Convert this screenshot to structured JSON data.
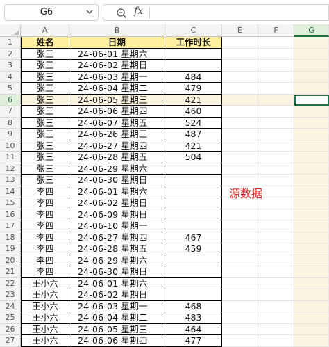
{
  "namebox": {
    "value": "G6"
  },
  "formula_bar": {
    "fx_label": "fx",
    "content": ""
  },
  "columns": [
    "A",
    "B",
    "C",
    "E",
    "F",
    "G"
  ],
  "selected_column": "G",
  "selected_row": "6",
  "headers": {
    "name": "姓名",
    "date": "日期",
    "hours": "工作时长"
  },
  "rows": [
    {
      "r": "2",
      "name": "张三",
      "date": "24-06-01  星期六",
      "hours": ""
    },
    {
      "r": "3",
      "name": "张三",
      "date": "24-06-02  星期日",
      "hours": ""
    },
    {
      "r": "4",
      "name": "张三",
      "date": "24-06-03  星期一",
      "hours": "484"
    },
    {
      "r": "5",
      "name": "张三",
      "date": "24-06-04  星期二",
      "hours": "479"
    },
    {
      "r": "6",
      "name": "张三",
      "date": "24-06-05  星期三",
      "hours": "421"
    },
    {
      "r": "7",
      "name": "张三",
      "date": "24-06-06  星期四",
      "hours": "460"
    },
    {
      "r": "8",
      "name": "张三",
      "date": "24-06-07  星期五",
      "hours": "524"
    },
    {
      "r": "9",
      "name": "张三",
      "date": "24-06-26  星期三",
      "hours": "487"
    },
    {
      "r": "10",
      "name": "张三",
      "date": "24-06-27  星期四",
      "hours": "421"
    },
    {
      "r": "11",
      "name": "张三",
      "date": "24-06-28  星期五",
      "hours": "504"
    },
    {
      "r": "12",
      "name": "张三",
      "date": "24-06-29  星期六",
      "hours": ""
    },
    {
      "r": "13",
      "name": "张三",
      "date": "24-06-30  星期日",
      "hours": ""
    },
    {
      "r": "14",
      "name": "李四",
      "date": "24-06-01  星期六",
      "hours": ""
    },
    {
      "r": "15",
      "name": "李四",
      "date": "24-06-02  星期日",
      "hours": ""
    },
    {
      "r": "16",
      "name": "李四",
      "date": "24-06-09  星期日",
      "hours": ""
    },
    {
      "r": "17",
      "name": "李四",
      "date": "24-06-10  星期一",
      "hours": ""
    },
    {
      "r": "18",
      "name": "李四",
      "date": "24-06-27  星期四",
      "hours": "467"
    },
    {
      "r": "19",
      "name": "李四",
      "date": "24-06-28  星期五",
      "hours": "459"
    },
    {
      "r": "20",
      "name": "李四",
      "date": "24-06-29  星期六",
      "hours": ""
    },
    {
      "r": "21",
      "name": "李四",
      "date": "24-06-30  星期日",
      "hours": ""
    },
    {
      "r": "22",
      "name": "王小六",
      "date": "24-06-01  星期六",
      "hours": ""
    },
    {
      "r": "23",
      "name": "王小六",
      "date": "24-06-02  星期日",
      "hours": ""
    },
    {
      "r": "24",
      "name": "王小六",
      "date": "24-06-03  星期一",
      "hours": "468"
    },
    {
      "r": "25",
      "name": "王小六",
      "date": "24-06-04  星期二",
      "hours": "483"
    },
    {
      "r": "26",
      "name": "王小六",
      "date": "24-06-05  星期三",
      "hours": "464"
    },
    {
      "r": "27",
      "name": "王小六",
      "date": "24-06-06  星期四",
      "hours": "477"
    }
  ],
  "annotation": "源数据",
  "colors": {
    "header_fill": "#ffef9f",
    "selection": "#1e7145",
    "highlight": "#fdf3e1",
    "annotation": "#e0201c"
  }
}
